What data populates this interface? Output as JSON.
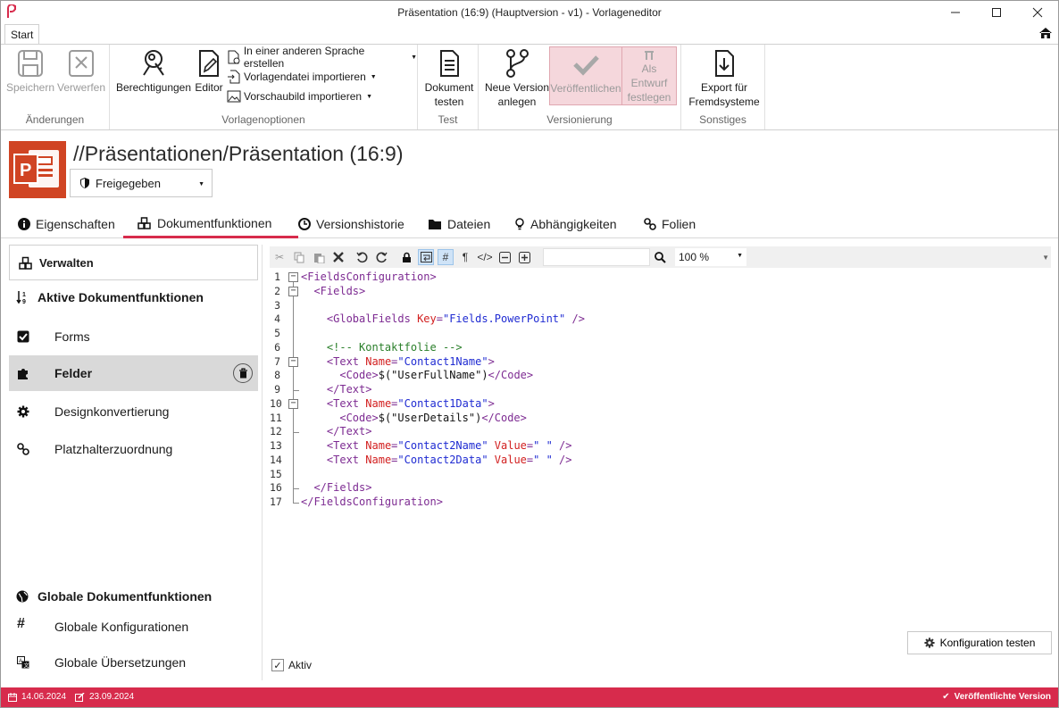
{
  "window": {
    "title": "Präsentation (16:9) (Hauptversion - v1) - Vorlageneditor",
    "start_tab": "Start"
  },
  "ribbon": {
    "groups": {
      "changes": "Änderungen",
      "template_options": "Vorlagenoptionen",
      "test": "Test",
      "versioning": "Versionierung",
      "other": "Sonstiges"
    },
    "save": "Speichern",
    "discard": "Verwerfen",
    "permissions": "Berechtigungen",
    "editor": "Editor",
    "other_language": "In einer anderen Sprache erstellen",
    "import_template": "Vorlagendatei importieren",
    "import_preview": "Vorschaubild importieren",
    "test_doc_1": "Dokument",
    "test_doc_2": "testen",
    "new_version_1": "Neue Version",
    "new_version_2": "anlegen",
    "publish": "Veröffentlichen",
    "draft_1": "Als Entwurf",
    "draft_2": "festlegen",
    "export_1": "Export für",
    "export_2": "Fremdsysteme"
  },
  "header": {
    "path": "//Präsentationen/Präsentation (16:9)",
    "status": "Freigegeben"
  },
  "tabs": {
    "properties": "Eigenschaften",
    "docfunctions": "Dokumentfunktionen",
    "history": "Versionshistorie",
    "files": "Dateien",
    "dependencies": "Abhängigkeiten",
    "slides": "Folien"
  },
  "left": {
    "manage": "Verwalten",
    "active_head": "Aktive Dokumentfunktionen",
    "items": [
      "Forms",
      "Felder",
      "Designkonvertierung",
      "Platzhalterzuordnung"
    ],
    "global_head": "Globale Dokumentfunktionen",
    "global_items": [
      "Globale Konfigurationen",
      "Globale Übersetzungen"
    ]
  },
  "editor": {
    "zoom": "100 %",
    "lines": [
      [
        [
          "tag",
          "<FieldsConfiguration>"
        ]
      ],
      [
        [
          "txt",
          "  "
        ],
        [
          "tag",
          "<Fields>"
        ]
      ],
      [],
      [
        [
          "txt",
          "    "
        ],
        [
          "tag",
          "<GlobalFields "
        ],
        [
          "attr",
          "Key"
        ],
        [
          "tag",
          "="
        ],
        [
          "val",
          "\"Fields.PowerPoint\""
        ],
        [
          "tag",
          " />"
        ]
      ],
      [],
      [
        [
          "txt",
          "    "
        ],
        [
          "cm",
          "<!-- Kontaktfolie -->"
        ]
      ],
      [
        [
          "txt",
          "    "
        ],
        [
          "tag",
          "<Text "
        ],
        [
          "attr",
          "Name"
        ],
        [
          "tag",
          "="
        ],
        [
          "val",
          "\"Contact1Name\""
        ],
        [
          "tag",
          ">"
        ]
      ],
      [
        [
          "txt",
          "      "
        ],
        [
          "tag",
          "<Code>"
        ],
        [
          "txt",
          "$(\"UserFullName\")"
        ],
        [
          "tag",
          "</Code>"
        ]
      ],
      [
        [
          "txt",
          "    "
        ],
        [
          "tag",
          "</Text>"
        ]
      ],
      [
        [
          "txt",
          "    "
        ],
        [
          "tag",
          "<Text "
        ],
        [
          "attr",
          "Name"
        ],
        [
          "tag",
          "="
        ],
        [
          "val",
          "\"Contact1Data\""
        ],
        [
          "tag",
          ">"
        ]
      ],
      [
        [
          "txt",
          "      "
        ],
        [
          "tag",
          "<Code>"
        ],
        [
          "txt",
          "$(\"UserDetails\")"
        ],
        [
          "tag",
          "</Code>"
        ]
      ],
      [
        [
          "txt",
          "    "
        ],
        [
          "tag",
          "</Text>"
        ]
      ],
      [
        [
          "txt",
          "    "
        ],
        [
          "tag",
          "<Text "
        ],
        [
          "attr",
          "Name"
        ],
        [
          "tag",
          "="
        ],
        [
          "val",
          "\"Contact2Name\" "
        ],
        [
          "attr",
          "Value"
        ],
        [
          "tag",
          "="
        ],
        [
          "val",
          "\" \""
        ],
        [
          "tag",
          " />"
        ]
      ],
      [
        [
          "txt",
          "    "
        ],
        [
          "tag",
          "<Text "
        ],
        [
          "attr",
          "Name"
        ],
        [
          "tag",
          "="
        ],
        [
          "val",
          "\"Contact2Data\" "
        ],
        [
          "attr",
          "Value"
        ],
        [
          "tag",
          "="
        ],
        [
          "val",
          "\" \""
        ],
        [
          "tag",
          " />"
        ]
      ],
      [],
      [
        [
          "txt",
          "  "
        ],
        [
          "tag",
          "</Fields>"
        ]
      ],
      [
        [
          "tag",
          "</FieldsConfiguration>"
        ]
      ]
    ],
    "test_button": "Konfiguration testen",
    "active_label": "Aktiv"
  },
  "status": {
    "created": "14.06.2024",
    "modified": "23.09.2024",
    "state": "Veröffentlichte Version"
  },
  "colors": {
    "accent": "#d72b4c",
    "ppt": "#d04423"
  }
}
